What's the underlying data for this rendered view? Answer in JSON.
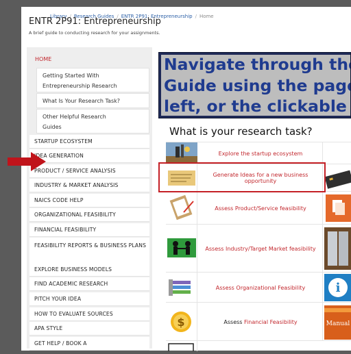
{
  "breadcrumb": {
    "items": [
      "Library",
      "Research Guides",
      "ENTR 2P91: Entrepreneurship",
      "Home"
    ]
  },
  "page": {
    "title": "ENTR 2P91: Entrepreneurship",
    "subtitle": "A brief guide to conducting research for your assignments."
  },
  "sidebar": {
    "home_label": "HOME",
    "subpages": [
      {
        "line1": "Getting Started With",
        "line2": "Entrepreneurship Research"
      },
      {
        "line1": "What Is Your Research Task?",
        "line2": ""
      },
      {
        "line1": "Other Helpful Research",
        "line2": "Guides"
      }
    ],
    "items": [
      {
        "label": "STARTUP ECOSYSTEM"
      },
      {
        "label": "IDEA GENERATION"
      },
      {
        "label": "PRODUCT / SERVICE ANALYSIS"
      },
      {
        "label": "INDUSTRY & MARKET ANALYSIS"
      },
      {
        "label": "NAICS CODE HELP"
      },
      {
        "label": "ORGANIZATIONAL FEASIBILITY"
      },
      {
        "label": "FINANCIAL FEASIBILITY"
      },
      {
        "label": "FEASIBILITY REPORTS & BUSINESS PLANS"
      },
      {
        "label": "EXPLORE BUSINESS MODELS"
      },
      {
        "label": "FIND ACADEMIC RESEARCH"
      },
      {
        "label": "PITCH YOUR IDEA"
      },
      {
        "label": "HOW TO EVALUATE SOURCES"
      },
      {
        "label": "APA STYLE"
      },
      {
        "label": "GET HELP / BOOK A"
      }
    ]
  },
  "callout": {
    "lines": [
      "Navigate through the",
      "Guide using the page",
      "left, or the clickable ic"
    ]
  },
  "main": {
    "task_heading": "What is your research task?",
    "tasks": [
      {
        "label": "Explore the startup ecosystem"
      },
      {
        "label": "Generate Ideas for a new business opportunity"
      },
      {
        "label": "Assess Product/Service feasibility"
      },
      {
        "label": "Assess Industry/Target Market feasibility"
      },
      {
        "label": "Assess Organizational Feasibility"
      },
      {
        "label": "Assess",
        "label_link": "Financial Feasibility"
      }
    ],
    "side_manual_text": "Manual"
  },
  "colors": {
    "accent_red": "#c2272d",
    "callout_navy": "#1f2a57",
    "callout_text": "#1f3b8f",
    "link_blue": "#2b5fa6"
  }
}
